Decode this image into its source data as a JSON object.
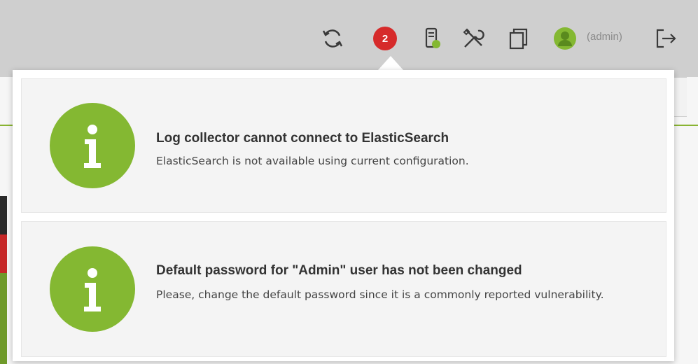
{
  "header": {
    "notification_count": "2",
    "user_label": "(admin)",
    "icons": [
      "refresh-icon",
      "notifications-badge",
      "database-status-icon",
      "tools-icon",
      "copy-icon",
      "user-avatar-icon",
      "logout-icon"
    ],
    "colors": {
      "badge": "#d62b2b",
      "accent_green": "#84b832"
    }
  },
  "notifications": [
    {
      "icon": "info-icon",
      "title": "Log collector cannot connect to ElasticSearch",
      "body": "ElasticSearch is not available using current configuration."
    },
    {
      "icon": "info-icon",
      "title": "Default password for \"Admin\" user has not been changed",
      "body": "Please, change the default password since it is a commonly reported vulnerability."
    }
  ]
}
